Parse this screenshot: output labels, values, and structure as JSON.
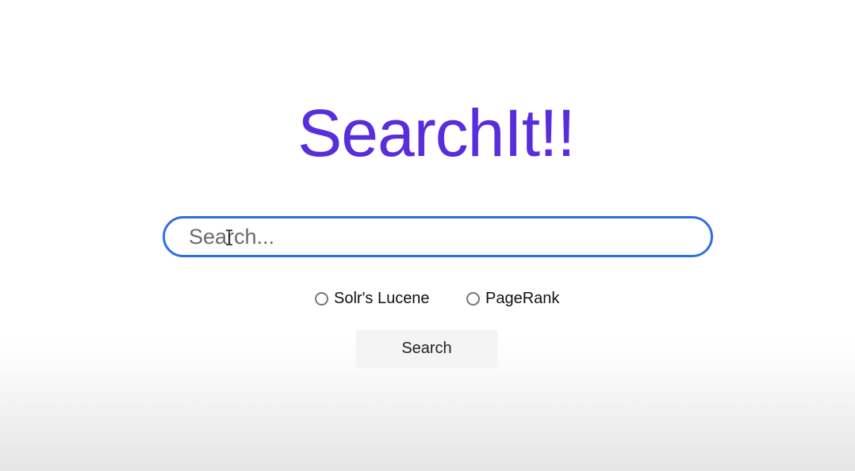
{
  "header": {
    "title": "SearchIt!!"
  },
  "search": {
    "placeholder": "Search..."
  },
  "ranking_options": [
    {
      "label": "Solr's Lucene",
      "selected": false
    },
    {
      "label": "PageRank",
      "selected": false
    }
  ],
  "actions": {
    "search_label": "Search"
  },
  "colors": {
    "title": "#5a2ddb",
    "input_border": "#2f6fe0",
    "button_bg": "#f4f4f5"
  },
  "icons": {
    "cursor": "text-cursor-icon"
  }
}
